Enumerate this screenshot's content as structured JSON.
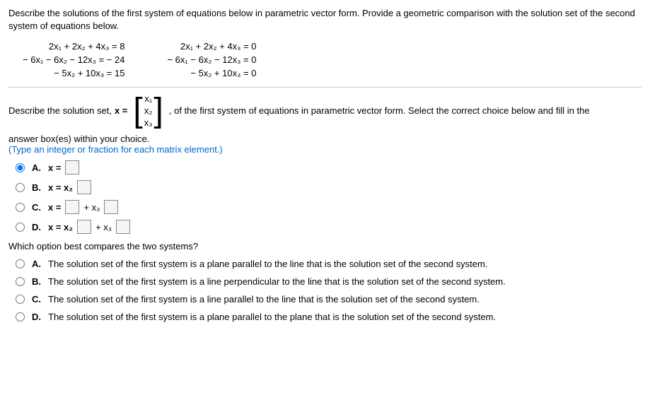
{
  "instruction": "Describe the solutions of the first system of equations below in parametric vector form. Provide a geometric comparison with the solution set of the second system of equations below.",
  "system1": {
    "eq1": "2x₁ + 2x₂ + 4x₃ = 8",
    "eq2": "− 6x₁ − 6x₂ − 12x₃ = − 24",
    "eq3": "− 5x₂ + 10x₃ = 15"
  },
  "system2": {
    "eq1": "2x₁ + 2x₂ + 4x₃ = 0",
    "eq2": "− 6x₁ − 6x₂ − 12x₃ = 0",
    "eq3": "− 5x₂ + 10x₃ = 0"
  },
  "describe_prefix": "Describe the solution set, ",
  "x_equals": "x = ",
  "matrix": {
    "r1": "x₁",
    "r2": "x₂",
    "r3": "x₃"
  },
  "describe_suffix": ", of the first system of equations in parametric vector form. Select the correct choice below and fill in the",
  "answer_box_text": "answer box(es) within your choice.",
  "type_text": "(Type an integer or fraction for each matrix element.)",
  "choices": {
    "A": {
      "label": "A.",
      "prefix": "x = "
    },
    "B": {
      "label": "B.",
      "prefix": "x = x₂"
    },
    "C": {
      "label": "C.",
      "prefix": "x = ",
      "mid": " + x₃"
    },
    "D": {
      "label": "D.",
      "prefix": "x = x₂",
      "mid": " + x₃"
    }
  },
  "compare_question": "Which option best compares the two systems?",
  "compare": {
    "A": {
      "label": "A.",
      "text": "The solution set of the first system is a plane parallel to the line that is the solution set of the second system."
    },
    "B": {
      "label": "B.",
      "text": "The solution set of the first system is a line perpendicular to the line that is the solution set of the second system."
    },
    "C": {
      "label": "C.",
      "text": "The solution set of the first system is a line parallel to the line that is the solution set of the second system."
    },
    "D": {
      "label": "D.",
      "text": "The solution set of the first system is a plane parallel to the plane that is the solution set of the second system."
    }
  }
}
